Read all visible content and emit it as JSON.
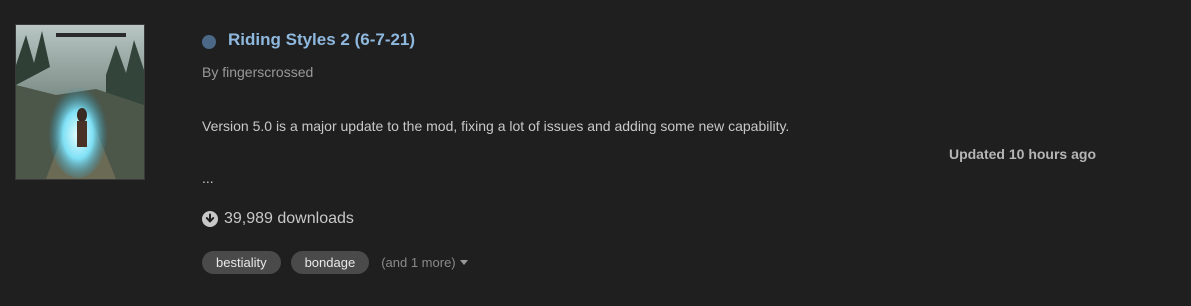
{
  "mod": {
    "title": "Riding Styles 2 (6-7-21)",
    "author_line": "By fingerscrossed",
    "description": "Version 5.0 is a major update to the mod, fixing a lot of issues and adding some new capability.",
    "ellipsis": "...",
    "updated": "Updated 10 hours ago",
    "downloads": "39,989 downloads",
    "tags": [
      "bestiality",
      "bondage"
    ],
    "more_tags": "(and 1 more)"
  },
  "colors": {
    "background": "#1f1f1f",
    "title": "#8fb8de",
    "status_dot": "#4b6887",
    "tag_bg": "#4a4a4a"
  },
  "icons": {
    "status": "status-dot-icon",
    "download": "download-circle-icon",
    "caret": "caret-down-icon"
  }
}
